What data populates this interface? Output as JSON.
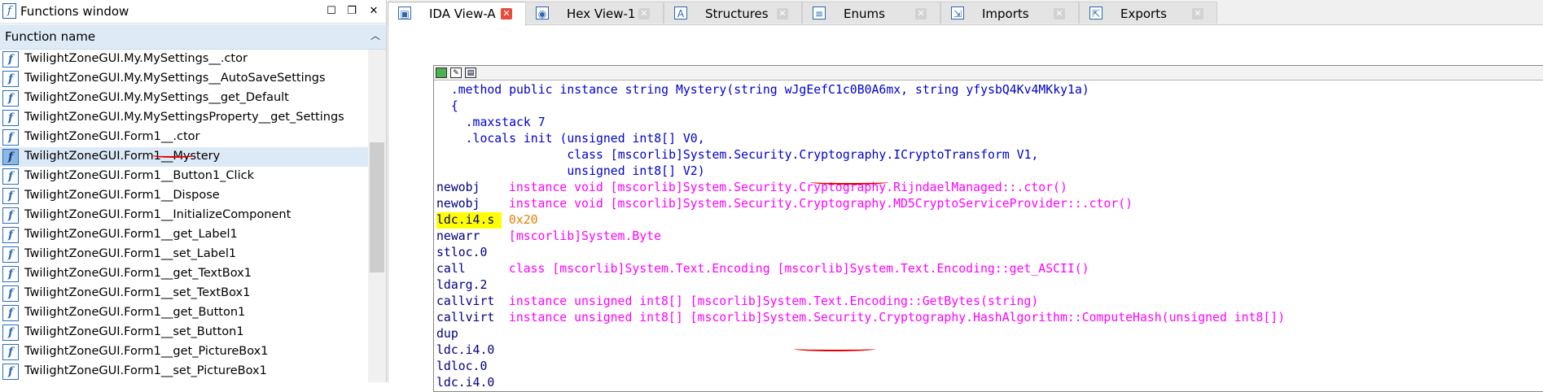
{
  "functions_window": {
    "title": "Functions window",
    "column_header": "Function name",
    "functions": [
      "TwilightZoneGUI.My.MySettings__.ctor",
      "TwilightZoneGUI.My.MySettings__AutoSaveSettings",
      "TwilightZoneGUI.My.MySettings__get_Default",
      "TwilightZoneGUI.My.MySettingsProperty__get_Settings",
      "TwilightZoneGUI.Form1__.ctor",
      "TwilightZoneGUI.Form1__Mystery",
      "TwilightZoneGUI.Form1__Button1_Click",
      "TwilightZoneGUI.Form1__Dispose",
      "TwilightZoneGUI.Form1__InitializeComponent",
      "TwilightZoneGUI.Form1__get_Label1",
      "TwilightZoneGUI.Form1__set_Label1",
      "TwilightZoneGUI.Form1__get_TextBox1",
      "TwilightZoneGUI.Form1__set_TextBox1",
      "TwilightZoneGUI.Form1__get_Button1",
      "TwilightZoneGUI.Form1__set_Button1",
      "TwilightZoneGUI.Form1__get_PictureBox1",
      "TwilightZoneGUI.Form1__set_PictureBox1"
    ],
    "selected_index": 5
  },
  "tabs": [
    {
      "label": "IDA View-A",
      "icon": "ida-view-icon",
      "active": true
    },
    {
      "label": "Hex View-1",
      "icon": "hex-view-icon",
      "active": false
    },
    {
      "label": "Structures",
      "icon": "structures-icon",
      "active": false
    },
    {
      "label": "Enums",
      "icon": "enums-icon",
      "active": false
    },
    {
      "label": "Imports",
      "icon": "imports-icon",
      "active": false
    },
    {
      "label": "Exports",
      "icon": "exports-icon",
      "active": false
    }
  ],
  "code": {
    "header": [
      "  .method public instance string Mystery(string wJgEefC1c0B0A6mx, string yfysbQ4Kv4MKky1a)",
      "  {",
      "    .maxstack 7",
      "    .locals init (unsigned int8[] V0,",
      "                  class [mscorlib]System.Security.Cryptography.ICryptoTransform V1,",
      "                  unsigned int8[] V2)"
    ],
    "instructions": [
      {
        "op": "newobj",
        "arg": "instance void [mscorlib]System.Security.Cryptography.RijndaelManaged::.ctor()"
      },
      {
        "op": "newobj",
        "arg": "instance void [mscorlib]System.Security.Cryptography.MD5CryptoServiceProvider::.ctor()"
      },
      {
        "op": "ldc.i4.s",
        "arg": "0x20",
        "numeric": true,
        "highlight": true
      },
      {
        "op": "newarr",
        "arg": "[mscorlib]System.Byte"
      },
      {
        "op": "stloc.0",
        "arg": ""
      },
      {
        "op": "call",
        "arg": "class [mscorlib]System.Text.Encoding [mscorlib]System.Text.Encoding::get_ASCII()"
      },
      {
        "op": "ldarg.2",
        "arg": ""
      },
      {
        "op": "callvirt",
        "arg": "instance unsigned int8[] [mscorlib]System.Text.Encoding::GetBytes(string)"
      },
      {
        "op": "callvirt",
        "arg": "instance unsigned int8[] [mscorlib]System.Security.Cryptography.HashAlgorithm::ComputeHash(unsigned int8[])"
      },
      {
        "op": "dup",
        "arg": ""
      },
      {
        "op": "ldc.i4.0",
        "arg": ""
      },
      {
        "op": "ldloc.0",
        "arg": ""
      },
      {
        "op": "ldc.i4.0",
        "arg": ""
      }
    ]
  },
  "colors": {
    "mnemonic": "#000080",
    "operand": "#ff00ff",
    "number": "#e67e00",
    "header": "#0000d0",
    "highlight": "#ffff00",
    "annotation": "#e00000"
  }
}
